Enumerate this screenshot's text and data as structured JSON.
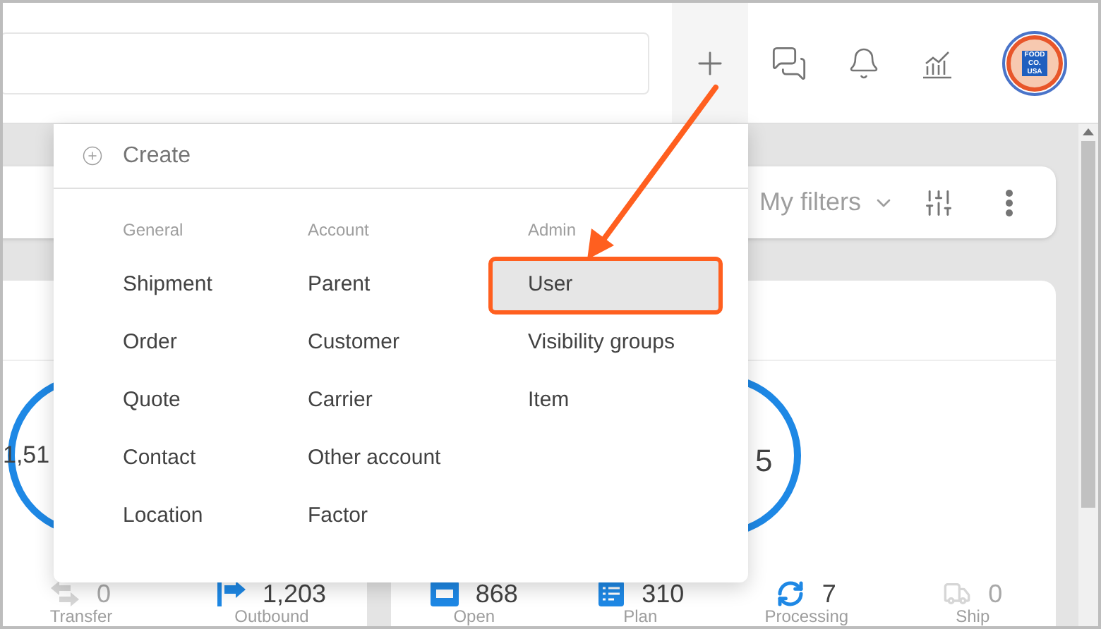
{
  "header": {
    "avatar_lines": [
      "FOOD",
      "CO.",
      "USA"
    ]
  },
  "filters": {
    "label": "My filters"
  },
  "summary_cards": [
    {
      "ring_value": "1,51",
      "stats": [
        {
          "kind": "transfer",
          "value": "0",
          "label": "Transfer",
          "disabled": true
        },
        {
          "kind": "outbound",
          "value": "1,203",
          "label": "Outbound",
          "disabled": false
        }
      ]
    },
    {
      "ring_value": "5",
      "stats": [
        {
          "kind": "open",
          "value": "868",
          "label": "Open",
          "disabled": false
        },
        {
          "kind": "plan",
          "value": "310",
          "label": "Plan",
          "disabled": false
        },
        {
          "kind": "processing",
          "value": "7",
          "label": "Processing",
          "disabled": false
        },
        {
          "kind": "ship",
          "value": "0",
          "label": "Ship",
          "disabled": true
        }
      ]
    }
  ],
  "create_menu": {
    "title": "Create",
    "columns": [
      {
        "heading": "General",
        "items": [
          {
            "label": "Shipment",
            "selected": false
          },
          {
            "label": "Order",
            "selected": false
          },
          {
            "label": "Quote",
            "selected": false
          },
          {
            "label": "Contact",
            "selected": false
          },
          {
            "label": "Location",
            "selected": false
          }
        ]
      },
      {
        "heading": "Account",
        "items": [
          {
            "label": "Parent",
            "selected": false
          },
          {
            "label": "Customer",
            "selected": false
          },
          {
            "label": "Carrier",
            "selected": false
          },
          {
            "label": "Other account",
            "selected": false
          },
          {
            "label": "Factor",
            "selected": false
          }
        ]
      },
      {
        "heading": "Admin",
        "items": [
          {
            "label": "User",
            "selected": true
          },
          {
            "label": "Visibility groups",
            "selected": false
          },
          {
            "label": "Item",
            "selected": false
          }
        ]
      }
    ]
  }
}
